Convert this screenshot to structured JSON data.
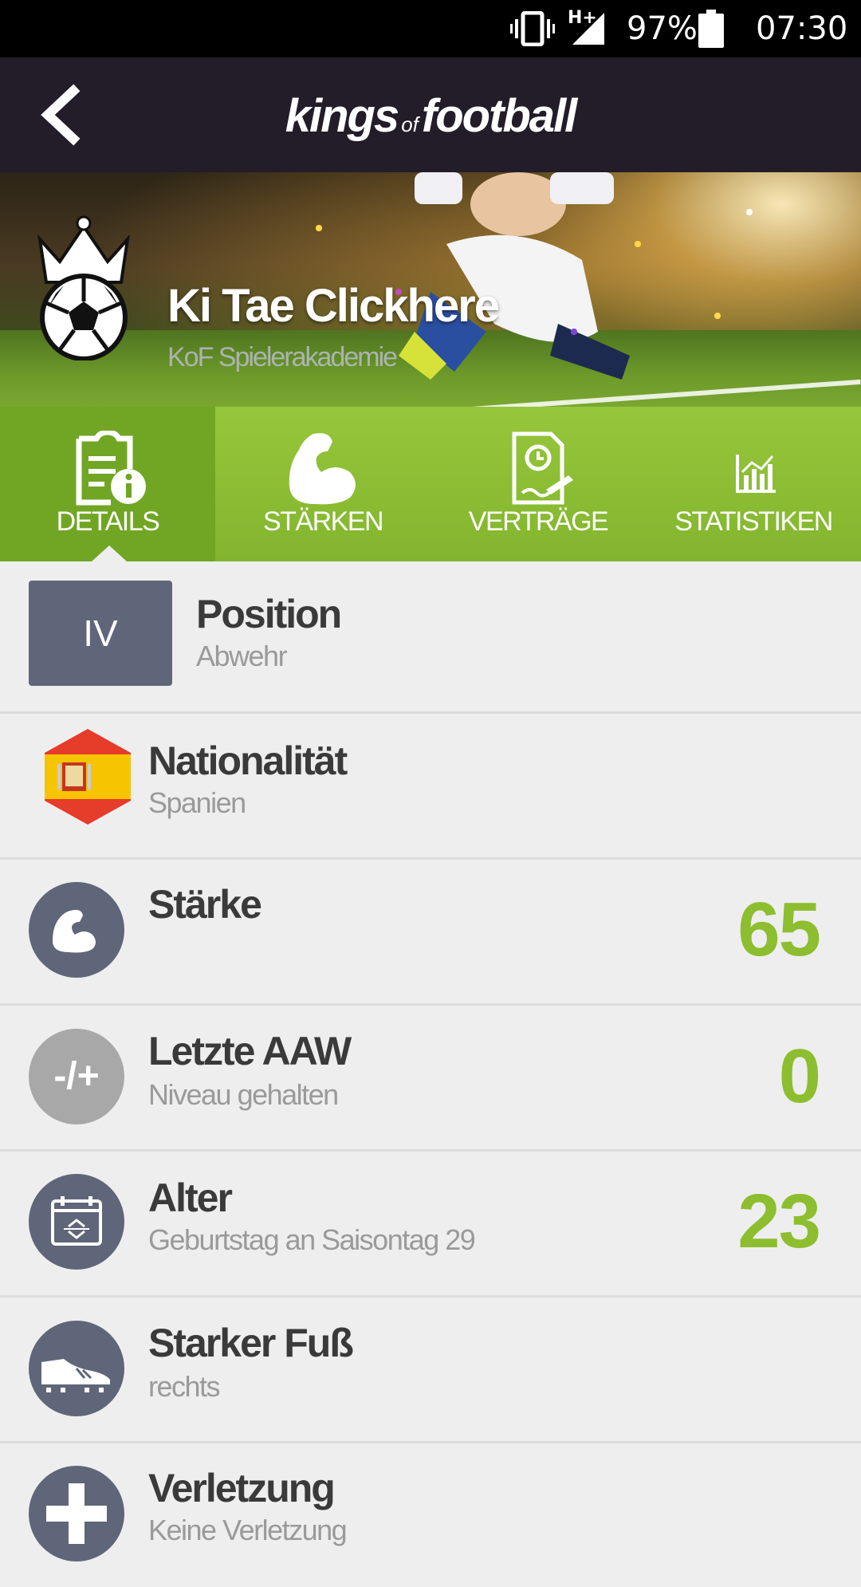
{
  "status_bar": {
    "network": "H+",
    "battery": "97%",
    "time": "07:30"
  },
  "app_bar": {
    "logo_main_left": "kings",
    "logo_of": "of",
    "logo_main_right": "football"
  },
  "player": {
    "name": "Ki Tae Clickhere",
    "club": "KoF Spielerakademie"
  },
  "tabs": [
    {
      "label": "DETAILS",
      "icon": "details-info-icon",
      "active": true
    },
    {
      "label": "STÄRKEN",
      "icon": "biceps-icon",
      "active": false
    },
    {
      "label": "VERTRÄGE",
      "icon": "contract-icon",
      "active": false
    },
    {
      "label": "STATISTIKEN",
      "icon": "stats-chart-icon",
      "active": false
    }
  ],
  "details": {
    "position": {
      "badge": "IV",
      "title": "Position",
      "sub": "Abwehr"
    },
    "nationality": {
      "title": "Nationalität",
      "sub": "Spanien",
      "icon": "spain-flag-icon"
    },
    "strength": {
      "title": "Stärke",
      "value": "65",
      "icon": "biceps-icon"
    },
    "last_aaw": {
      "title": "Letzte AAW",
      "sub": "Niveau gehalten",
      "value": "0",
      "icon_text": "-/+"
    },
    "age": {
      "title": "Alter",
      "sub": "Geburtstag an Saisontag 29",
      "value": "23",
      "icon": "calendar-icon"
    },
    "strong_foot": {
      "title": "Starker Fuß",
      "sub": "rechts",
      "icon": "boot-icon"
    },
    "injury": {
      "title": "Verletzung",
      "sub": "Keine Verletzung",
      "icon": "plus-icon"
    }
  },
  "colors": {
    "accent_green": "#8cbe2f",
    "icon_gray": "#5f6679",
    "app_bar": "#231c29"
  }
}
